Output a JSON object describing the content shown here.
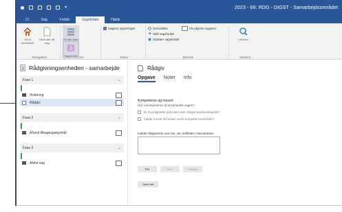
{
  "window": {
    "title": "2023 - 66: RDG - DIGST - Samarbejdsområdet"
  },
  "ribbon_tabs": [
    "Cl",
    "Sag",
    "Forløb",
    "Sagsforløb",
    "Hjælp"
  ],
  "ribbon": {
    "navigation": {
      "label": "Navigation",
      "btn_home": "Gå til forretsnivå",
      "btn_up": "Gå til alle ulf-sag"
    },
    "vis": {
      "label": "Vis",
      "btn_vis_alle": "Vis alle faser",
      "btn_sagsforloeb": "Sagsforløb"
    },
    "menu": {
      "label": "Menu",
      "btn_sagens": "Sagens oplysninger"
    },
    "diverse": {
      "label": "Diverse",
      "genindlaes": "Genindlæs",
      "skift": "Skift sagsforløb",
      "opdater": "Opdater sagsforløb",
      "vis_opgaver": "Vis afgivne opgaver"
    },
    "csearch": {
      "label": "cSearch",
      "btn": "cSearch"
    }
  },
  "left_pane": {
    "title": "Rådgivningsenheden - samarbejde",
    "phases": [
      {
        "name": "Fase 1",
        "tasks": [
          {
            "label": "Visitering",
            "active": false
          },
          {
            "label": "Rådgiv",
            "active": true
          }
        ]
      },
      {
        "name": "Fase 2",
        "tasks": [
          {
            "label": "Afvent tilbagespørgsmål",
            "active": false
          }
        ]
      },
      {
        "name": "Fase 3",
        "tasks": [
          {
            "label": "Afslut sag",
            "active": false
          }
        ]
      }
    ]
  },
  "right_pane": {
    "title": "Rådgiv",
    "tabs": [
      "Opgave",
      "Noter",
      "Info"
    ],
    "section_title": "Kompetence og ressort",
    "section_sub": "Har vi kompetence til at behandle sagen?",
    "checkbox_1": "Er myndigheden på listen over rådgivningsberettigede?",
    "checkbox_2": "Falder emnet ind under vores kompetenceområde?",
    "instruction": "Indsæt rådgivende svar her, der indflettes i besvarelsen.",
    "btn_ret": "Ret",
    "btn_gem": "Gem",
    "btn_fortryd": "Fortryd",
    "btn_open": "Opret akt"
  }
}
